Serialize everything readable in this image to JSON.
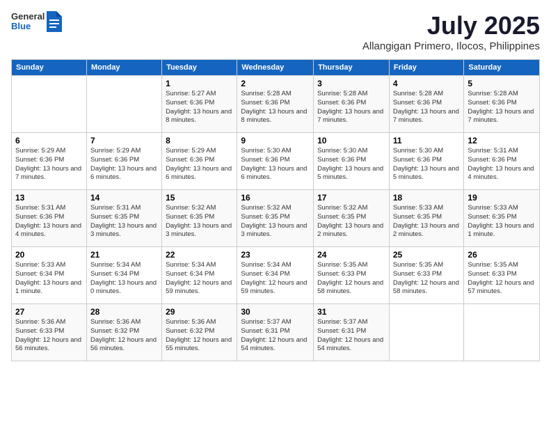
{
  "header": {
    "logo_general": "General",
    "logo_blue": "Blue",
    "month_title": "July 2025",
    "location": "Allangigan Primero, Ilocos, Philippines"
  },
  "days_of_week": [
    "Sunday",
    "Monday",
    "Tuesday",
    "Wednesday",
    "Thursday",
    "Friday",
    "Saturday"
  ],
  "weeks": [
    [
      {
        "day": "",
        "info": ""
      },
      {
        "day": "",
        "info": ""
      },
      {
        "day": "1",
        "info": "Sunrise: 5:27 AM\nSunset: 6:36 PM\nDaylight: 13 hours and 8 minutes."
      },
      {
        "day": "2",
        "info": "Sunrise: 5:28 AM\nSunset: 6:36 PM\nDaylight: 13 hours and 8 minutes."
      },
      {
        "day": "3",
        "info": "Sunrise: 5:28 AM\nSunset: 6:36 PM\nDaylight: 13 hours and 7 minutes."
      },
      {
        "day": "4",
        "info": "Sunrise: 5:28 AM\nSunset: 6:36 PM\nDaylight: 13 hours and 7 minutes."
      },
      {
        "day": "5",
        "info": "Sunrise: 5:28 AM\nSunset: 6:36 PM\nDaylight: 13 hours and 7 minutes."
      }
    ],
    [
      {
        "day": "6",
        "info": "Sunrise: 5:29 AM\nSunset: 6:36 PM\nDaylight: 13 hours and 7 minutes."
      },
      {
        "day": "7",
        "info": "Sunrise: 5:29 AM\nSunset: 6:36 PM\nDaylight: 13 hours and 6 minutes."
      },
      {
        "day": "8",
        "info": "Sunrise: 5:29 AM\nSunset: 6:36 PM\nDaylight: 13 hours and 6 minutes."
      },
      {
        "day": "9",
        "info": "Sunrise: 5:30 AM\nSunset: 6:36 PM\nDaylight: 13 hours and 6 minutes."
      },
      {
        "day": "10",
        "info": "Sunrise: 5:30 AM\nSunset: 6:36 PM\nDaylight: 13 hours and 5 minutes."
      },
      {
        "day": "11",
        "info": "Sunrise: 5:30 AM\nSunset: 6:36 PM\nDaylight: 13 hours and 5 minutes."
      },
      {
        "day": "12",
        "info": "Sunrise: 5:31 AM\nSunset: 6:36 PM\nDaylight: 13 hours and 4 minutes."
      }
    ],
    [
      {
        "day": "13",
        "info": "Sunrise: 5:31 AM\nSunset: 6:36 PM\nDaylight: 13 hours and 4 minutes."
      },
      {
        "day": "14",
        "info": "Sunrise: 5:31 AM\nSunset: 6:35 PM\nDaylight: 13 hours and 3 minutes."
      },
      {
        "day": "15",
        "info": "Sunrise: 5:32 AM\nSunset: 6:35 PM\nDaylight: 13 hours and 3 minutes."
      },
      {
        "day": "16",
        "info": "Sunrise: 5:32 AM\nSunset: 6:35 PM\nDaylight: 13 hours and 3 minutes."
      },
      {
        "day": "17",
        "info": "Sunrise: 5:32 AM\nSunset: 6:35 PM\nDaylight: 13 hours and 2 minutes."
      },
      {
        "day": "18",
        "info": "Sunrise: 5:33 AM\nSunset: 6:35 PM\nDaylight: 13 hours and 2 minutes."
      },
      {
        "day": "19",
        "info": "Sunrise: 5:33 AM\nSunset: 6:35 PM\nDaylight: 13 hours and 1 minute."
      }
    ],
    [
      {
        "day": "20",
        "info": "Sunrise: 5:33 AM\nSunset: 6:34 PM\nDaylight: 13 hours and 1 minute."
      },
      {
        "day": "21",
        "info": "Sunrise: 5:34 AM\nSunset: 6:34 PM\nDaylight: 13 hours and 0 minutes."
      },
      {
        "day": "22",
        "info": "Sunrise: 5:34 AM\nSunset: 6:34 PM\nDaylight: 12 hours and 59 minutes."
      },
      {
        "day": "23",
        "info": "Sunrise: 5:34 AM\nSunset: 6:34 PM\nDaylight: 12 hours and 59 minutes."
      },
      {
        "day": "24",
        "info": "Sunrise: 5:35 AM\nSunset: 6:33 PM\nDaylight: 12 hours and 58 minutes."
      },
      {
        "day": "25",
        "info": "Sunrise: 5:35 AM\nSunset: 6:33 PM\nDaylight: 12 hours and 58 minutes."
      },
      {
        "day": "26",
        "info": "Sunrise: 5:35 AM\nSunset: 6:33 PM\nDaylight: 12 hours and 57 minutes."
      }
    ],
    [
      {
        "day": "27",
        "info": "Sunrise: 5:36 AM\nSunset: 6:33 PM\nDaylight: 12 hours and 56 minutes."
      },
      {
        "day": "28",
        "info": "Sunrise: 5:36 AM\nSunset: 6:32 PM\nDaylight: 12 hours and 56 minutes."
      },
      {
        "day": "29",
        "info": "Sunrise: 5:36 AM\nSunset: 6:32 PM\nDaylight: 12 hours and 55 minutes."
      },
      {
        "day": "30",
        "info": "Sunrise: 5:37 AM\nSunset: 6:31 PM\nDaylight: 12 hours and 54 minutes."
      },
      {
        "day": "31",
        "info": "Sunrise: 5:37 AM\nSunset: 6:31 PM\nDaylight: 12 hours and 54 minutes."
      },
      {
        "day": "",
        "info": ""
      },
      {
        "day": "",
        "info": ""
      }
    ]
  ]
}
